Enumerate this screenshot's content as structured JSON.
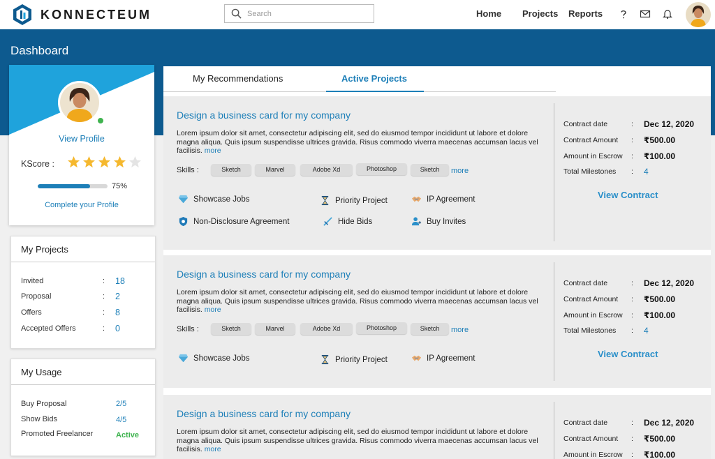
{
  "header": {
    "brand": "KONNECTEUM",
    "search_placeholder": "Search",
    "nav": [
      "Home",
      "Projects",
      "Reports"
    ]
  },
  "page_title": "Dashboard",
  "profile": {
    "view_profile": "View Profile",
    "kscore_label": "KScore :",
    "rating": 4,
    "rating_max": 5,
    "progress_percent": 75,
    "progress_label": "75%",
    "complete_profile": "Complete your Profile"
  },
  "my_projects": {
    "title": "My Projects",
    "rows": [
      {
        "label": "Invited",
        "value": "18"
      },
      {
        "label": "Proposal",
        "value": "2"
      },
      {
        "label": "Offers",
        "value": "8"
      },
      {
        "label": "Accepted Offers",
        "value": "0"
      }
    ]
  },
  "my_usage": {
    "title": "My Usage",
    "rows": [
      {
        "label": "Buy Proposal",
        "value": "2/5"
      },
      {
        "label": "Show Bids",
        "value": "4/5"
      },
      {
        "label": "Promoted Freelancer",
        "value": "Active"
      }
    ]
  },
  "tabs": [
    "My Recommendations",
    "Active Projects"
  ],
  "projects": [
    {
      "title": "Design a business card for my company",
      "desc": "Lorem ipsum dolor sit amet, consectetur adipiscing elit, sed do eiusmod tempor incididunt ut labore et dolore magna aliqua. Quis ipsum suspendisse ultrices gravida. Risus commodo viverra maecenas accumsan lacus vel facilisis.",
      "more": "more",
      "skills_label": "Skills :",
      "skills": [
        "Sketch",
        "Marvel",
        "Adobe Xd",
        "Photoshop",
        "Sketch"
      ],
      "skills_more": "more",
      "features": [
        "Showcase Jobs",
        "Priority Project",
        "IP Agreement",
        "Non-Disclosure Agreement",
        "Hide Bids",
        "Buy Invites"
      ],
      "contract": {
        "date_label": "Contract date",
        "date": "Dec 12, 2020",
        "amount_label": "Contract Amount",
        "amount": "₹500.00",
        "escrow_label": "Amount in Escrow",
        "escrow": "₹100.00",
        "milestones_label": "Total Milestones",
        "milestones": "4",
        "view": "View Contract"
      }
    },
    {
      "title": "Design a business card for my company",
      "desc": "Lorem ipsum dolor sit amet, consectetur adipiscing elit, sed do eiusmod tempor incididunt ut labore et dolore magna aliqua. Quis ipsum suspendisse ultrices gravida. Risus commodo viverra maecenas accumsan lacus vel facilisis.",
      "more": "more",
      "skills_label": "Skills :",
      "skills": [
        "Sketch",
        "Marvel",
        "Adobe Xd",
        "Photoshop",
        "Sketch"
      ],
      "skills_more": "more",
      "features": [
        "Showcase Jobs",
        "Priority Project",
        "IP Agreement"
      ],
      "contract": {
        "date_label": "Contract date",
        "date": "Dec 12, 2020",
        "amount_label": "Contract Amount",
        "amount": "₹500.00",
        "escrow_label": "Amount in Escrow",
        "escrow": "₹100.00",
        "milestones_label": "Total Milestones",
        "milestones": "4",
        "view": "View Contract"
      }
    },
    {
      "title": "Design a business card for my company",
      "desc": "Lorem ipsum dolor sit amet, consectetur adipiscing elit, sed do eiusmod tempor incididunt ut labore et dolore magna aliqua. Quis ipsum suspendisse ultrices gravida. Risus commodo viverra maecenas accumsan lacus vel facilisis.",
      "more": "more",
      "contract": {
        "date_label": "Contract date",
        "date": "Dec 12, 2020",
        "amount_label": "Contract Amount",
        "amount": "₹500.00",
        "escrow_label": "Amount in Escrow",
        "escrow": "₹100.00"
      }
    }
  ],
  "colors": {
    "brand_blue": "#0d5a8f",
    "accent": "#1d7fb8",
    "cyan": "#1fa3dc",
    "success": "#3fb34f",
    "star": "#f5b82e"
  },
  "icons": [
    "search-icon",
    "help-icon",
    "mail-icon",
    "bell-icon",
    "diamond-icon",
    "hourglass-icon",
    "handshake-icon",
    "shield-icon",
    "hide-bids-icon",
    "buy-invites-icon"
  ]
}
